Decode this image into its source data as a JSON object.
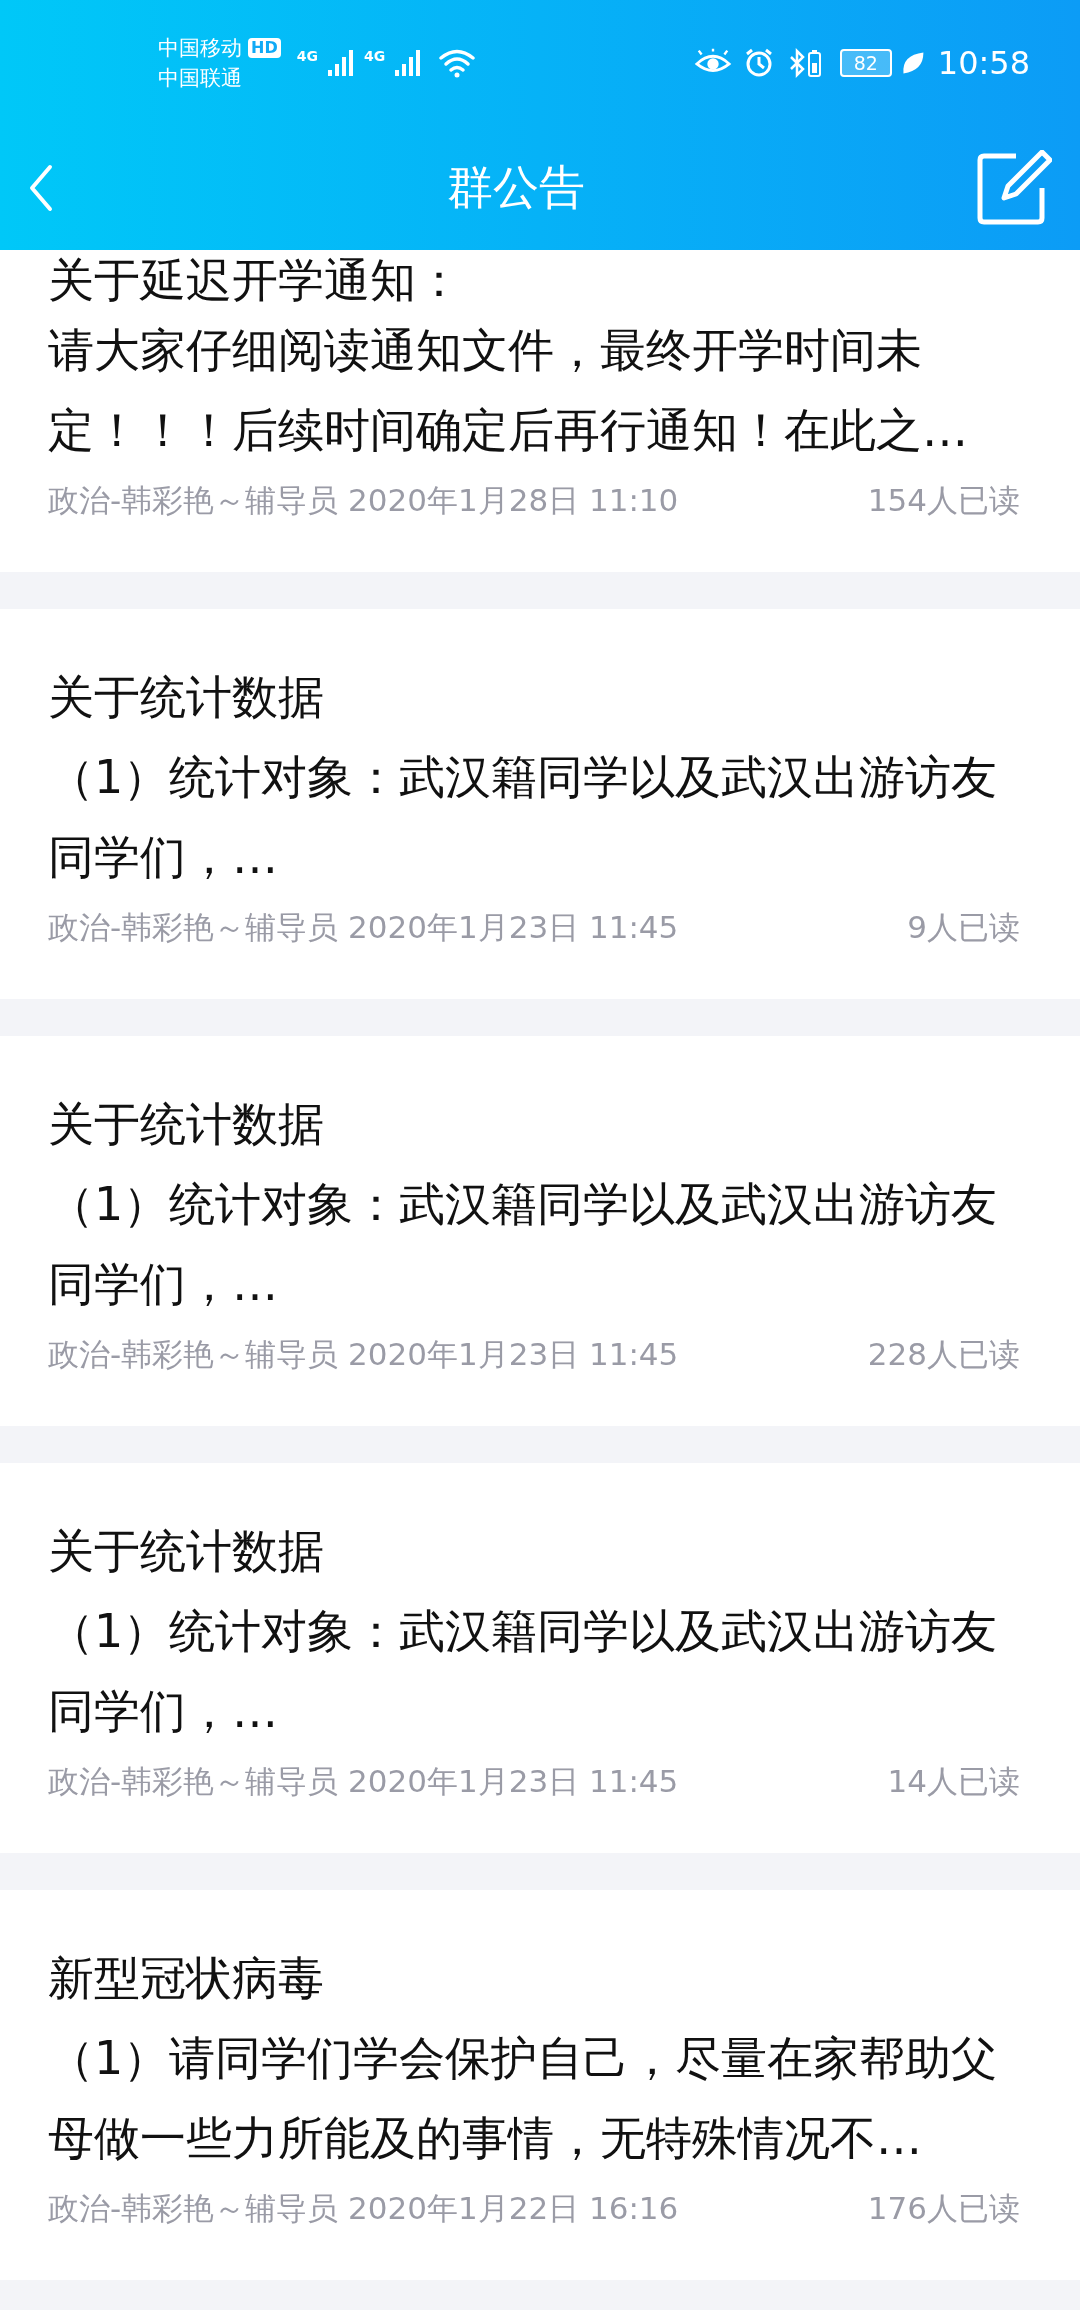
{
  "status_bar": {
    "carrier_1": "中国移动",
    "hd_badge": "HD",
    "carrier_2": "中国联通",
    "network_1": "4G",
    "network_2": "4G",
    "battery": "82",
    "time": "10:58"
  },
  "header": {
    "title": "群公告"
  },
  "notices": [
    {
      "title": "关于延迟开学通知：",
      "body": "请大家仔细阅读通知文件，最终开学时间未定！！！后续时间确定后再行通知！在此之…",
      "author_time": "政治-韩彩艳～辅导员 2020年1月28日 11:10",
      "read_count": "154人已读"
    },
    {
      "title": "关于统计数据",
      "body": "（1）统计对象：武汉籍同学以及武汉出游访友同学们，…",
      "author_time": "政治-韩彩艳～辅导员 2020年1月23日 11:45",
      "read_count": "9人已读"
    },
    {
      "title": "关于统计数据",
      "body": "（1）统计对象：武汉籍同学以及武汉出游访友同学们，…",
      "author_time": "政治-韩彩艳～辅导员 2020年1月23日 11:45",
      "read_count": "228人已读"
    },
    {
      "title": "关于统计数据",
      "body": "（1）统计对象：武汉籍同学以及武汉出游访友同学们，…",
      "author_time": "政治-韩彩艳～辅导员 2020年1月23日 11:45",
      "read_count": "14人已读"
    },
    {
      "title": "新型冠状病毒",
      "body": "（1）请同学们学会保护自己，尽量在家帮助父母做一些力所能及的事情，无特殊情况不…",
      "author_time": "政治-韩彩艳～辅导员 2020年1月22日 16:16",
      "read_count": "176人已读"
    }
  ]
}
